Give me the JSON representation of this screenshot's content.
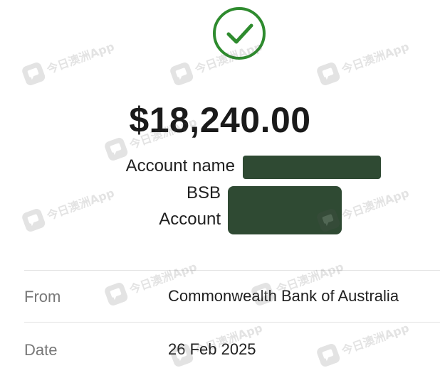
{
  "status": {
    "icon": "check-circle-icon",
    "color": "#2e8b2e"
  },
  "payment": {
    "amount": "$18,240.00"
  },
  "account": {
    "name_label": "Account name",
    "bsb_label": "BSB",
    "number_label": "Account",
    "redaction_color": "#2f4a33"
  },
  "details": {
    "from_label": "From",
    "from_value": "Commonwealth Bank of Australia",
    "date_label": "Date",
    "date_value": "26 Feb 2025"
  },
  "watermark": {
    "text": "今日澳洲App",
    "logo": "chat-bubble-logo-icon"
  }
}
